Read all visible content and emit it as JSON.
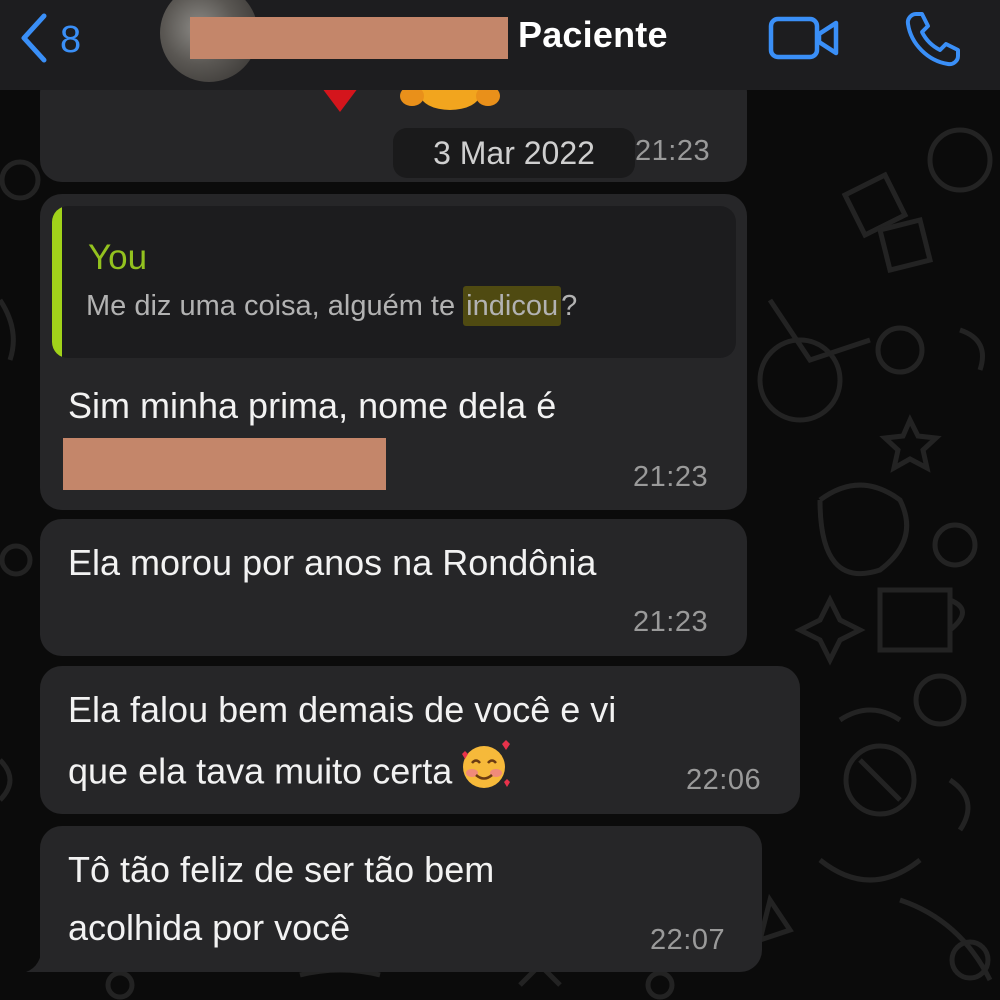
{
  "header": {
    "back_count": "8",
    "contact_name": "Paciente"
  },
  "date_chip": "3 Mar 2022",
  "messages": [
    {
      "time": "21:23"
    },
    {
      "reply": {
        "author": "You",
        "text_before": "Me diz uma coisa, alguém te ",
        "highlight": "indicou",
        "text_after": "?"
      },
      "text": "Sim minha prima, nome dela é",
      "time": "21:23"
    },
    {
      "text": "Ela morou por anos na Rondônia",
      "time": "21:23"
    },
    {
      "line1": "Ela falou bem demais de você e vi",
      "line2": "que ela tava muito certa",
      "time": "22:06"
    },
    {
      "line1": "Tô tão feliz de ser tão bem",
      "line2": "acolhida por você",
      "time": "22:07"
    }
  ],
  "colors": {
    "accent": "#3a8ff7",
    "bubble": "#262628",
    "quote_accent": "#a1d21a",
    "redaction": "#c4866a"
  },
  "icons": [
    "chevron-left-icon",
    "video-camera-icon",
    "phone-icon",
    "smiling-face-with-hearts-emoji"
  ]
}
